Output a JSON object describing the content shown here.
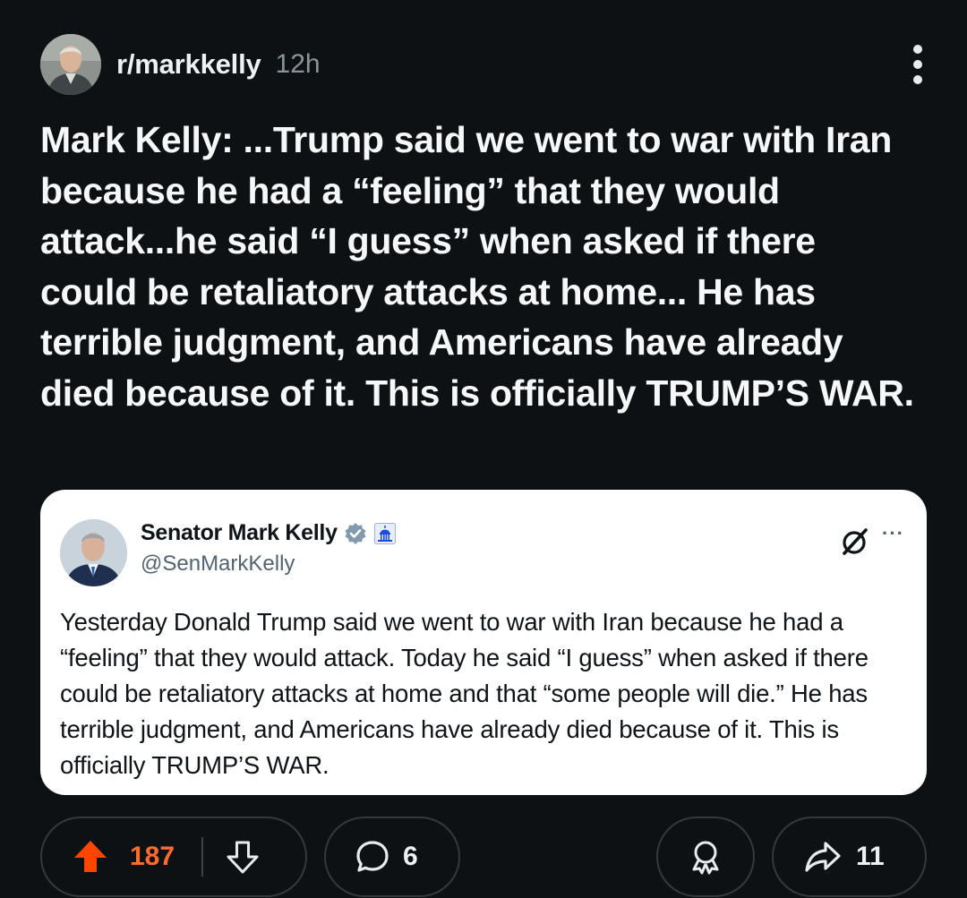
{
  "post": {
    "subreddit": "r/markkelly",
    "age": "12h",
    "title": "Mark Kelly: ...Trump said we went to war with Iran because he had a “feeling” that they would attack...he said “I guess” when asked if there could be retaliatory attacks at home... He has terrible judgment, and Americans have already died because of it. This is officially TRUMP’S WAR."
  },
  "tweet": {
    "display_name": "Senator Mark Kelly",
    "handle": "@SenMarkKelly",
    "more_label": "···",
    "text": "Yesterday Donald Trump said we went to war with Iran because he had a “feeling” that they would attack. Today he said “I guess” when asked if there could be retaliatory attacks at home and that “some people will die.” He has terrible judgment, and Americans have already died because of it. This is officially TRUMP’S WAR."
  },
  "actions": {
    "score": "187",
    "comments": "6",
    "shares": "11"
  },
  "colors": {
    "background": "#0e1113",
    "upvote_active": "#ff4500",
    "score_active": "#ff6a2e",
    "verified_badge": "#829aab",
    "capitol_badge": "#1d4ed8"
  },
  "icons": {
    "overflow": "vertical-ellipsis-icon",
    "verified": "verified-badge-icon",
    "government": "capitol-icon",
    "grok": "xai-icon",
    "upvote": "upvote-arrow-icon",
    "downvote": "downvote-arrow-icon",
    "comment": "comment-bubble-icon",
    "award": "award-icon",
    "share": "share-arrow-icon"
  }
}
